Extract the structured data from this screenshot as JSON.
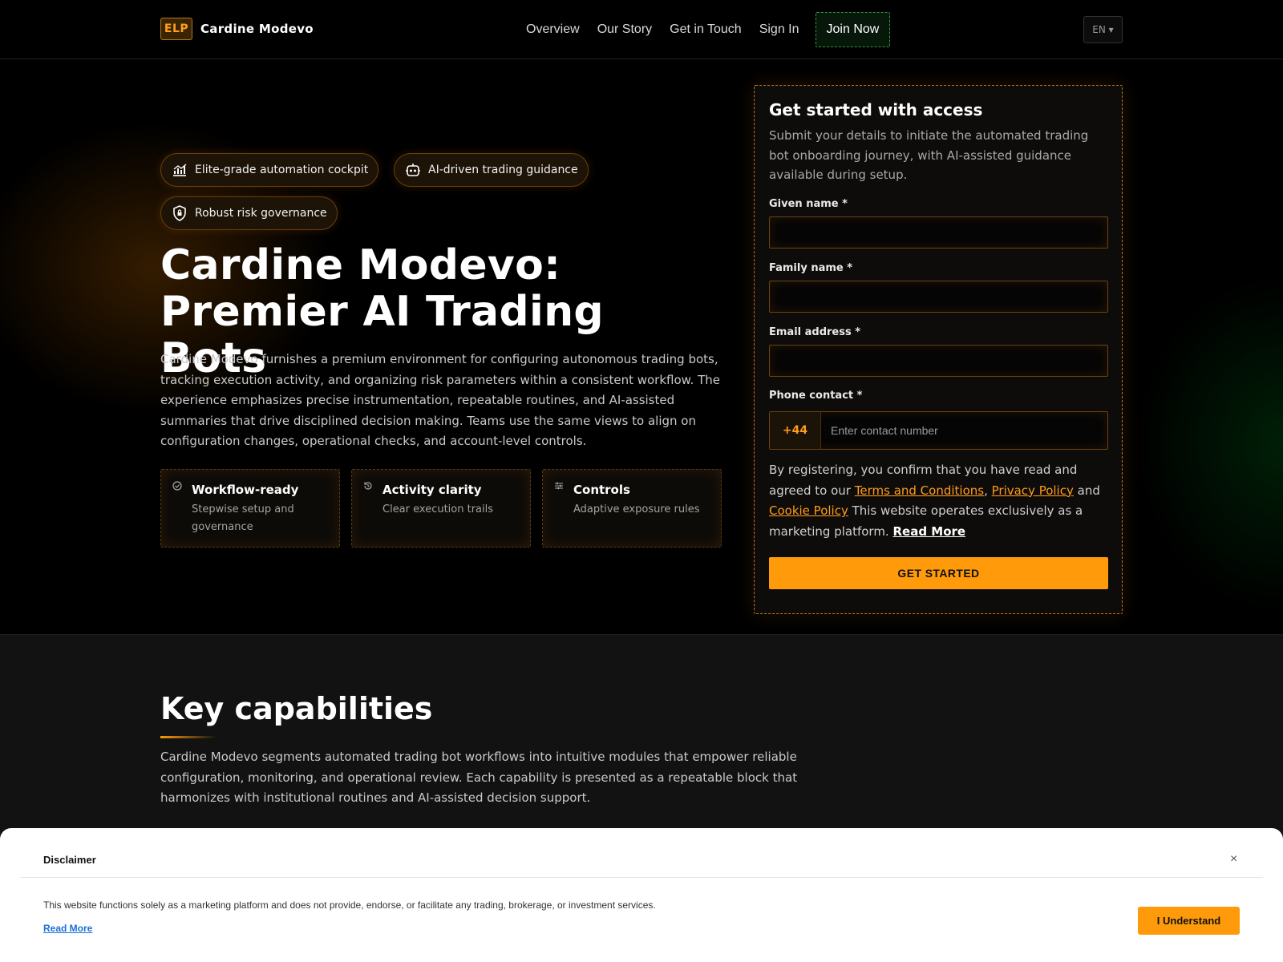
{
  "header": {
    "logo_badge": "ELP",
    "brand": "Cardine Modevo",
    "nav": [
      "Overview",
      "Our Story",
      "Get in Touch",
      "Sign In"
    ],
    "join_label": "Join Now",
    "language": "EN ▾"
  },
  "hero": {
    "pills": [
      {
        "label": "Elite-grade automation cockpit",
        "icon": "chart-icon"
      },
      {
        "label": "AI-driven trading guidance",
        "icon": "robot-icon"
      },
      {
        "label": "Robust risk governance",
        "icon": "shield-icon"
      }
    ],
    "title": "Cardine Modevo: Premier AI Trading Bots",
    "lead": "Cardine Modevo furnishes a premium environment for configuring autonomous trading bots, tracking execution activity, and organizing risk parameters within a consistent workflow. The experience emphasizes precise instrumentation, repeatable routines, and AI-assisted summaries that drive disciplined decision making. Teams use the same views to align on configuration changes, operational checks, and account-level controls.",
    "features": [
      {
        "title": "Workflow-ready",
        "desc": "Stepwise setup and governance",
        "icon": "check-circle-icon"
      },
      {
        "title": "Activity clarity",
        "desc": "Clear execution trails",
        "icon": "history-icon"
      },
      {
        "title": "Controls",
        "desc": "Adaptive exposure rules",
        "icon": "sliders-icon"
      }
    ]
  },
  "form": {
    "title": "Get started with access",
    "subtitle": "Submit your details to initiate the automated trading bot onboarding journey, with AI-assisted guidance available during setup.",
    "given_label": "Given name *",
    "family_label": "Family name *",
    "email_label": "Email address *",
    "phone_label": "Phone contact *",
    "country_code": "+44",
    "phone_placeholder": "Enter contact number",
    "consent_prefix": "By registering, you confirm that you have read and agreed to our ",
    "terms": "Terms and Conditions",
    "comma": ", ",
    "privacy": "Privacy Policy",
    "and": " and ",
    "cookie": "Cookie Policy",
    "consent_suffix": " This website operates exclusively as a marketing platform. ",
    "read_more": "Read More",
    "cta": "GET STARTED"
  },
  "capabilities": {
    "title": "Key capabilities",
    "text": "Cardine Modevo segments automated trading bot workflows into intuitive modules that empower reliable configuration, monitoring, and operational review. Each capability is presented as a repeatable block that harmonizes with institutional routines and AI-assisted decision support."
  },
  "disclaimer": {
    "title": "Disclaimer",
    "close": "×",
    "text": "This website functions solely as a marketing platform and does not provide, endorse, or facilitate any trading, brokerage, or investment services.",
    "read_more": "Read More",
    "button": "I Understand"
  },
  "colors": {
    "accent": "#ff9b0a",
    "join_border": "#2f9a3a",
    "background": "#000000"
  }
}
